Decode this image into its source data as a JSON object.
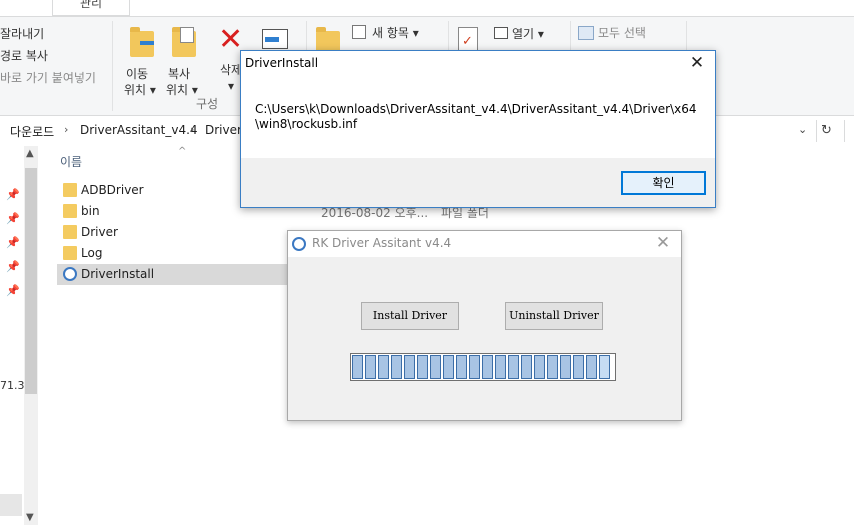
{
  "ribbon": {
    "tab_manage": "관리",
    "clipboard": {
      "cut": "잘라내기",
      "copy_path": "경로 복사",
      "paste_shortcut": "바로 가기 붙여넣기"
    },
    "organize": {
      "move_to": "이동",
      "move_to_sub": "위치 ▾",
      "copy_to": "복사",
      "copy_to_sub": "위치 ▾",
      "delete": "삭제",
      "delete_sub": "▾",
      "group_label": "구성"
    },
    "new": {
      "new_item": "새 항목 ▾"
    },
    "open": {
      "open": "열기 ▾"
    },
    "select": {
      "select_all": "모두 선택"
    }
  },
  "address": {
    "crumbs": [
      "다운로드",
      "DriverAssitant_v4.4",
      "DriverA"
    ],
    "separator": "›"
  },
  "file_list": {
    "header_name": "이름",
    "items": [
      {
        "name": "ADBDriver",
        "type": "folder"
      },
      {
        "name": "bin",
        "type": "folder"
      },
      {
        "name": "Driver",
        "type": "folder"
      },
      {
        "name": "Log",
        "type": "folder"
      },
      {
        "name": "DriverInstall",
        "type": "app",
        "selected": true
      }
    ],
    "partial_date": "2016-08-02 오후...",
    "partial_type": "파일 폴더",
    "left_edge_text": "71.3"
  },
  "dialog_driverinstall": {
    "title": "DriverInstall",
    "message": "C:\\Users\\k\\Downloads\\DriverAssitant_v4.4\\DriverAssitant_v4.4\\Driver\\x64\\win8\\rockusb.inf",
    "ok_label": "확인",
    "close_glyph": "✕"
  },
  "dialog_rk": {
    "title": "RK Driver Assitant v4.4",
    "install_label": "Install Driver",
    "uninstall_label": "Uninstall Driver",
    "close_glyph": "✕",
    "progress_blocks": 20
  },
  "colors": {
    "accent": "#0078d7",
    "dialog_border": "#3a7ec4",
    "progress_fill": "#a8c4e4",
    "selection": "#d9d9d9"
  }
}
